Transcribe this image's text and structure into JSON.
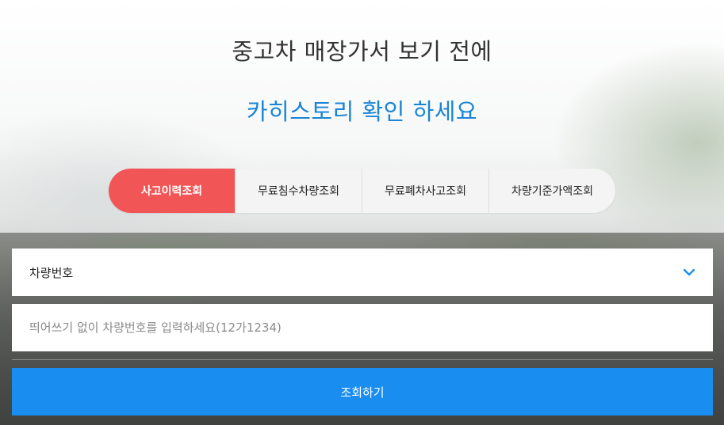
{
  "headline": {
    "line1": "중고차 매장가서 보기 전에",
    "line2": "카히스토리 확인 하세요"
  },
  "tabs": [
    {
      "label": "사고이력조회",
      "active": true
    },
    {
      "label": "무료침수차량조회",
      "active": false
    },
    {
      "label": "무료폐차사고조회",
      "active": false
    },
    {
      "label": "차량기준가액조회",
      "active": false
    }
  ],
  "search": {
    "type_select": {
      "value": "차량번호",
      "icon": "chevron-down-icon"
    },
    "input_placeholder": "띄어쓰기 없이 차량번호를 입력하세요(12가1234)",
    "input_value": "",
    "submit_label": "조회하기"
  },
  "colors": {
    "accent_red": "#f25555",
    "accent_blue": "#1a8ef0",
    "headline_blue": "#1a84d6"
  }
}
